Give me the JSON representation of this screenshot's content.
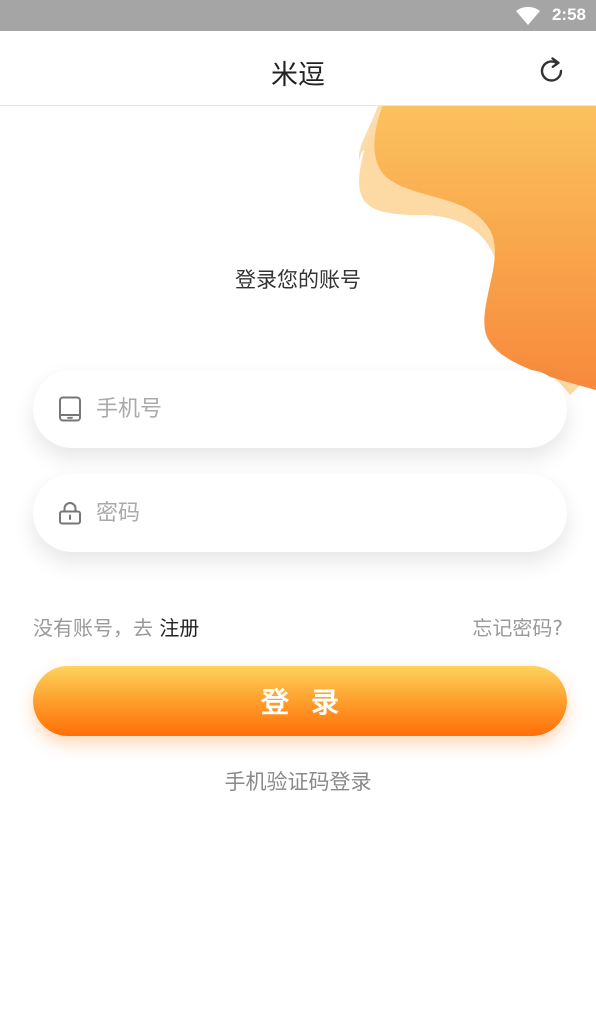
{
  "status_bar": {
    "time": "2:58",
    "wifi_icon": "wifi-icon"
  },
  "app_bar": {
    "title": "米逗",
    "refresh_icon": "refresh-icon"
  },
  "heading": "登录您的账号",
  "form": {
    "phone": {
      "placeholder": "手机号",
      "value": "",
      "icon": "phone-icon"
    },
    "password": {
      "placeholder": "密码",
      "value": "",
      "icon": "lock-icon"
    }
  },
  "links": {
    "no_account_prefix": "没有账号，去",
    "register": "注册",
    "forgot": "忘记密码?"
  },
  "login_button": "登录",
  "sms_login": "手机验证码登录",
  "colors": {
    "status_bar": "#a5a5a5",
    "accent_top": "#fcd35c",
    "accent_bottom": "#ff6f08",
    "blob_light": "#fcd9a3",
    "blob_main": "#f7a94a"
  }
}
